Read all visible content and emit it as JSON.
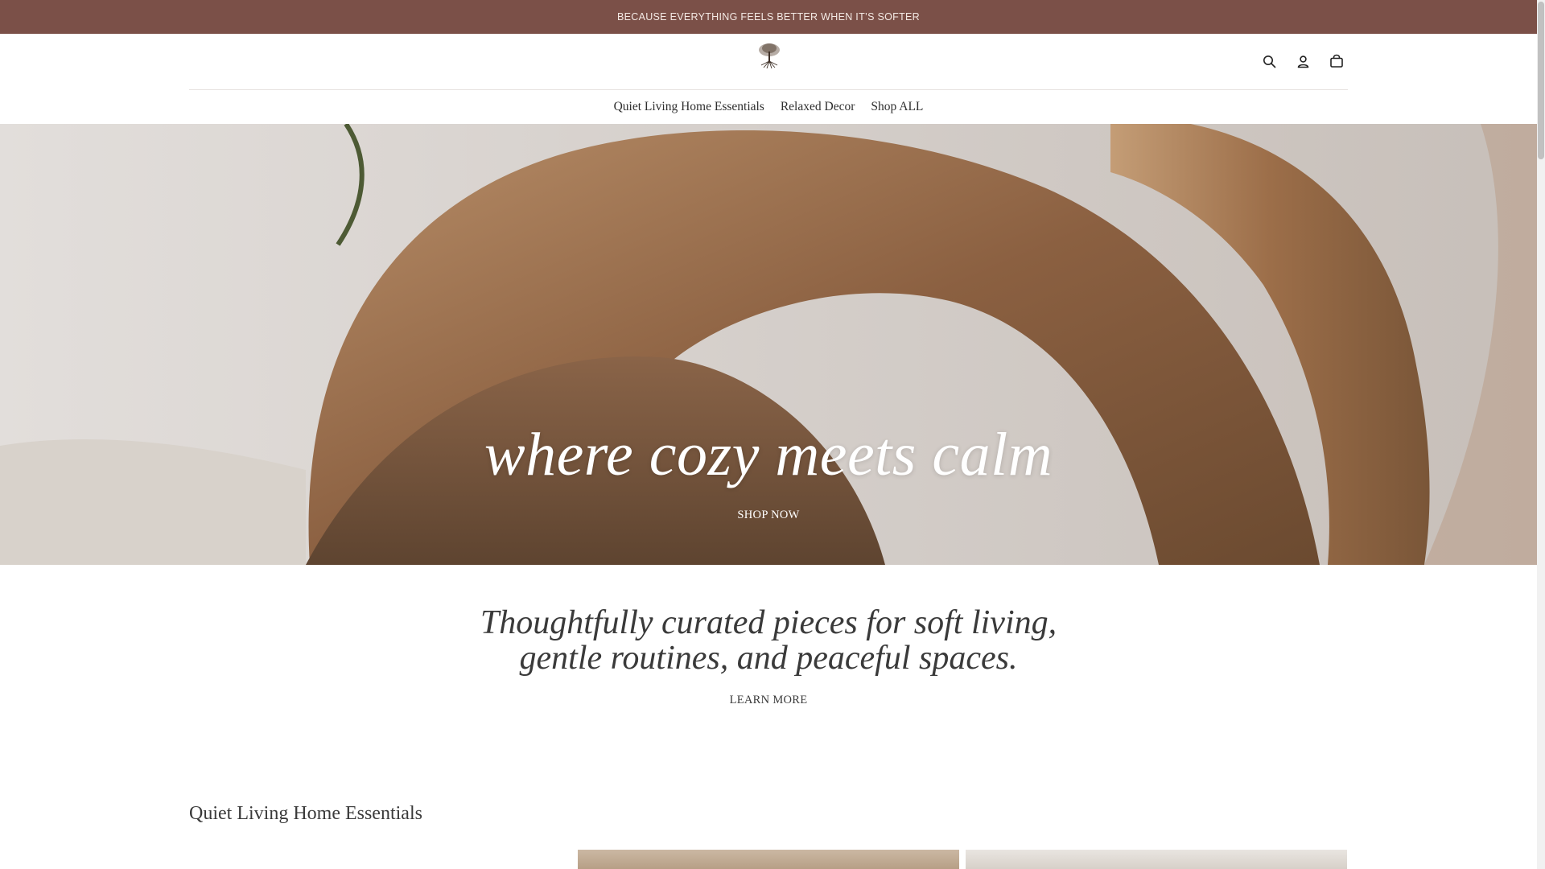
{
  "announcement": {
    "text": "BECAUSE EVERYTHING FEELS BETTER WHEN IT’S SOFTER"
  },
  "header": {
    "logo_icon": "tree-logo",
    "icons": [
      "search-icon",
      "account-icon",
      "cart-icon"
    ]
  },
  "nav": {
    "items": [
      {
        "label": "Quiet Living Home Essentials"
      },
      {
        "label": "Relaxed Decor"
      },
      {
        "label": "Shop ALL"
      }
    ]
  },
  "hero": {
    "title": "where cozy meets calm",
    "button_label": "SHOP NOW"
  },
  "intro": {
    "text": "Thoughtfully curated pieces for soft living, gentle routines, and peaceful spaces.",
    "button_label": "LEARN MORE"
  },
  "collection": {
    "title": "Quiet Living Home Essentials"
  },
  "colors": {
    "announcement_bg": "#7b5048",
    "text": "#2b2b2b"
  }
}
